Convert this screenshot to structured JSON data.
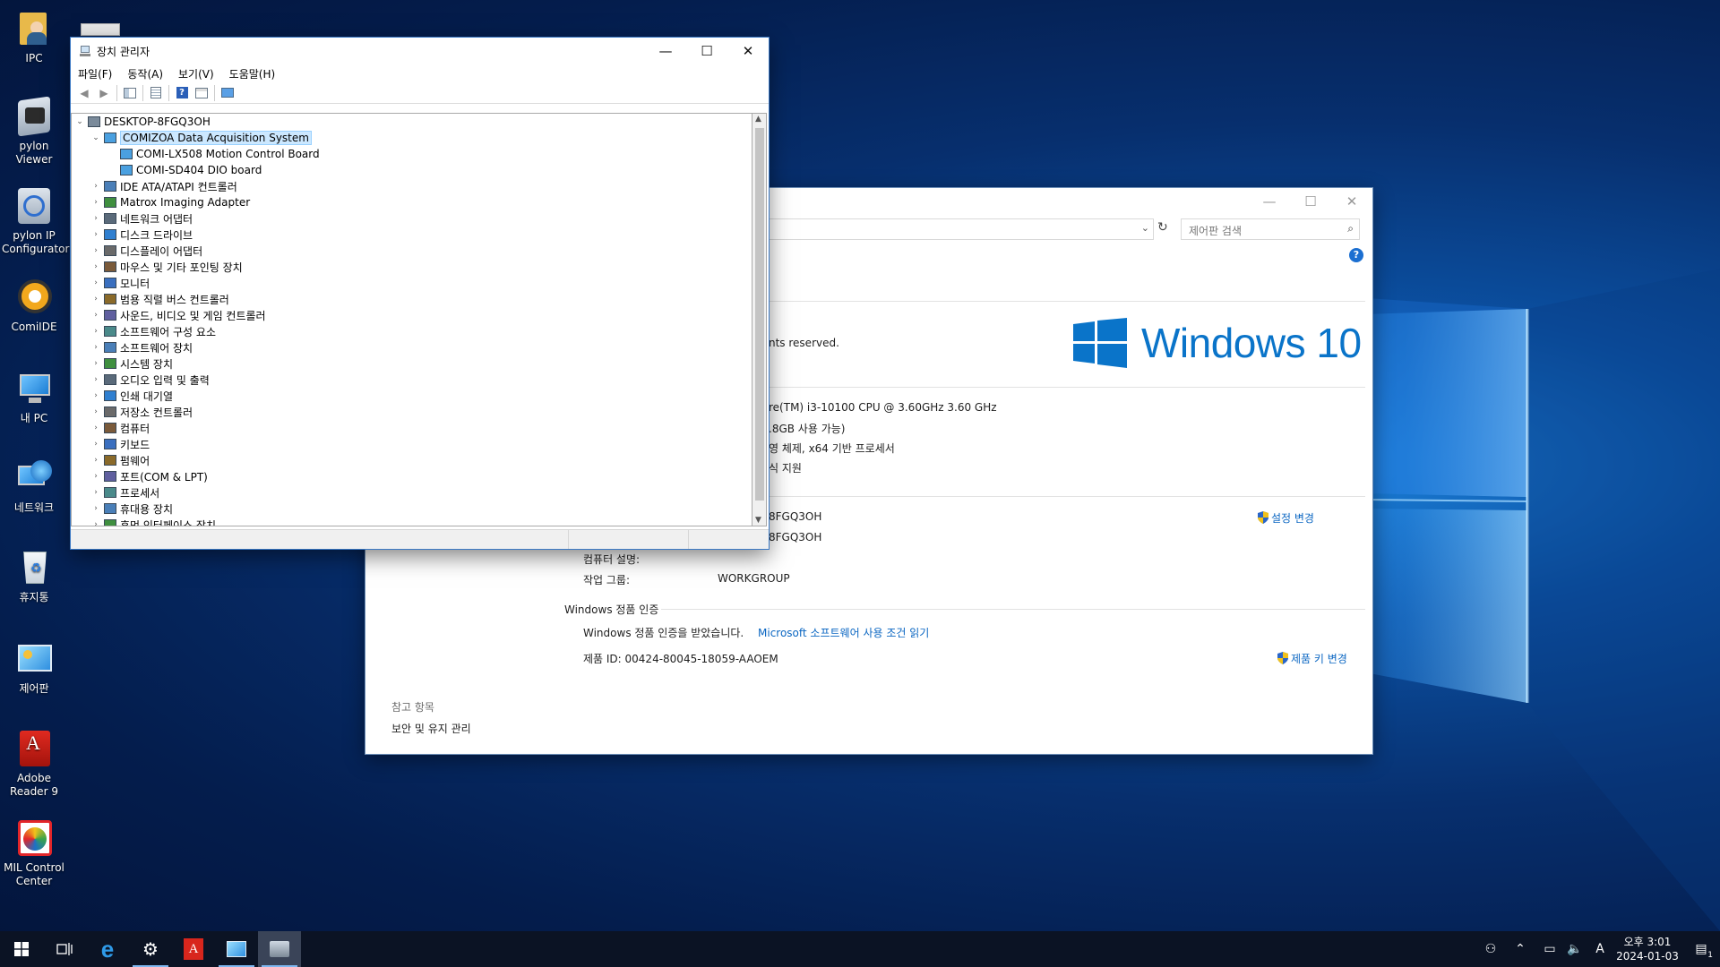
{
  "desktop": {
    "icons": [
      {
        "label": "IPC",
        "icon": "user-folder-icon"
      },
      {
        "label": "pylon Viewer",
        "icon": "pylon-viewer-icon"
      },
      {
        "label": "pylon IP Configurator",
        "icon": "pylon-ip-configurator-icon"
      },
      {
        "label": "ComiIDE",
        "icon": "comiide-icon"
      },
      {
        "label": "내 PC",
        "icon": "this-pc-icon"
      },
      {
        "label": "네트워크",
        "icon": "network-icon"
      },
      {
        "label": "휴지통",
        "icon": "recycle-bin-icon"
      },
      {
        "label": "제어판",
        "icon": "control-panel-icon"
      },
      {
        "label": "Adobe Reader 9",
        "icon": "adobe-reader-icon"
      },
      {
        "label": "MIL Control Center",
        "icon": "mil-control-center-icon"
      }
    ]
  },
  "device_manager": {
    "title": "장치 관리자",
    "menu": [
      "파일(F)",
      "동작(A)",
      "보기(V)",
      "도움말(H)"
    ],
    "root": "DESKTOP-8FGQ3OH",
    "expanded": {
      "label": "COMIZOA Data Acquisition System",
      "children": [
        "COMI-LX508 Motion Control Board",
        "COMI-SD404 DIO board"
      ]
    },
    "categories": [
      "IDE ATA/ATAPI 컨트롤러",
      "Matrox Imaging Adapter",
      "네트워크 어댑터",
      "디스크 드라이브",
      "디스플레이 어댑터",
      "마우스 및 기타 포인팅 장치",
      "모니터",
      "범용 직렬 버스 컨트롤러",
      "사운드, 비디오 및 게임 컨트롤러",
      "소프트웨어 구성 요소",
      "소프트웨어 장치",
      "시스템 장치",
      "오디오 입력 및 출력",
      "인쇄 대기열",
      "저장소 컨트롤러",
      "컴퓨터",
      "키보드",
      "펌웨어",
      "포트(COM & LPT)",
      "프로세서",
      "휴대용 장치",
      "휴먼 인터페이스 장치"
    ]
  },
  "system_window": {
    "search_placeholder": "제어판 검색",
    "copyright_fragment": "nts reserved.",
    "logo_text": "Windows 10",
    "processor": "re(TM) i3-10100 CPU @ 3.60GHz   3.60 GHz",
    "ram": ".8GB 사용 가능)",
    "system_type": "영 체제, x64 기반 프로세서",
    "pen_touch": "식 지원",
    "computer_name": "8FGQ3OH",
    "full_name": "8FGQ3OH",
    "description_label": "컴퓨터 설명:",
    "workgroup_label": "작업 그룹:",
    "workgroup_value": "WORKGROUP",
    "change_settings": "설정 변경",
    "activation_header": "Windows 정품 인증",
    "activation_status": "Windows 정품 인증을 받았습니다.",
    "license_link": "Microsoft 소프트웨어 사용 조건 읽기",
    "product_id": "제품 ID: 00424-80045-18059-AAOEM",
    "change_key": "제품 키 변경",
    "see_also": "참고 항목",
    "security_link": "보안 및 유지 관리"
  },
  "taskbar": {
    "clock_time": "오후 3:01",
    "clock_date": "2024-01-03",
    "ime": "A",
    "notification_count": "1"
  }
}
